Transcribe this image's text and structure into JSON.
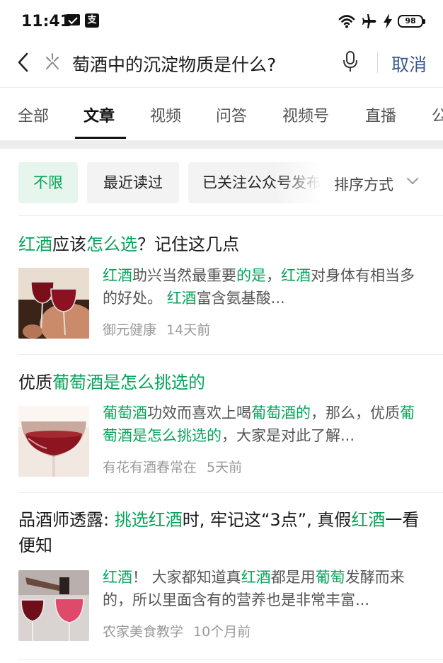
{
  "status_bar": {
    "time": "11:41",
    "pay_glyph": "支",
    "battery": "98"
  },
  "search": {
    "query": "萄酒中的沉淀物质是什么?",
    "cancel_label": "取消"
  },
  "tabs": [
    {
      "label": "全部"
    },
    {
      "label": "文章"
    },
    {
      "label": "视频"
    },
    {
      "label": "问答"
    },
    {
      "label": "视频号"
    },
    {
      "label": "直播"
    },
    {
      "label": "公"
    }
  ],
  "filters": {
    "chips": [
      {
        "label": "不限"
      },
      {
        "label": "最近读过"
      },
      {
        "label": "已关注公众号发布"
      }
    ],
    "sort_label": "排序方式"
  },
  "articles": [
    {
      "title": [
        {
          "t": "红酒",
          "hl": true
        },
        {
          "t": "应该",
          "hl": false
        },
        {
          "t": "怎么选",
          "hl": true
        },
        {
          "t": "？记住这几点",
          "hl": false
        }
      ],
      "snippet": [
        {
          "t": "红酒",
          "hl": true
        },
        {
          "t": "助兴当然最重要",
          "hl": false
        },
        {
          "t": "的是",
          "hl": true
        },
        {
          "t": "，",
          "hl": false
        },
        {
          "t": "红酒",
          "hl": true
        },
        {
          "t": "对身体有相当多的好处。 ",
          "hl": false
        },
        {
          "t": "红酒",
          "hl": true
        },
        {
          "t": "富含氨基酸...",
          "hl": false
        }
      ],
      "source": "御元健康",
      "time": "14天前"
    },
    {
      "title": [
        {
          "t": "优质",
          "hl": false
        },
        {
          "t": "葡萄酒是怎么挑选的",
          "hl": true
        }
      ],
      "snippet": [
        {
          "t": "葡萄酒",
          "hl": true
        },
        {
          "t": "功效而喜欢上喝",
          "hl": false
        },
        {
          "t": "葡萄酒的",
          "hl": true
        },
        {
          "t": "，那么，优质",
          "hl": false
        },
        {
          "t": "葡萄酒是怎么挑选的",
          "hl": true
        },
        {
          "t": "，大家是对此了解...",
          "hl": false
        }
      ],
      "source": "有花有酒春常在",
      "time": "5天前"
    },
    {
      "title": [
        {
          "t": "品酒师透露: ",
          "hl": false
        },
        {
          "t": "挑选红酒",
          "hl": true
        },
        {
          "t": "时, 牢记这“3点”, 真假",
          "hl": false
        },
        {
          "t": "红酒",
          "hl": true
        },
        {
          "t": "一看便知",
          "hl": false
        }
      ],
      "snippet": [
        {
          "t": "红酒",
          "hl": true
        },
        {
          "t": "！ 大家都知道真",
          "hl": false
        },
        {
          "t": "红酒",
          "hl": true
        },
        {
          "t": "都是用",
          "hl": false
        },
        {
          "t": "葡萄",
          "hl": true
        },
        {
          "t": "发酵而来的，所以里面含有的营养也是非常丰富...",
          "hl": false
        }
      ],
      "source": "农家美食教学",
      "time": "10个月前"
    }
  ],
  "colors": {
    "highlight": "#07a35a",
    "cancel": "#3a5a8c",
    "selected_chip_bg": "#e6f6ec"
  }
}
